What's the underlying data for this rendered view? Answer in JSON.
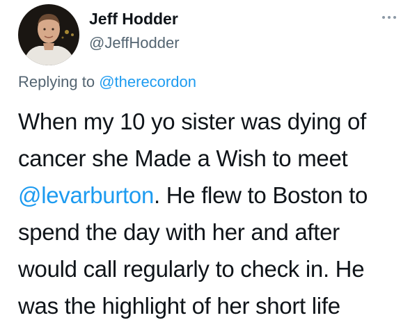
{
  "author": {
    "display_name": "Jeff Hodder",
    "handle": "@JeffHodder",
    "avatar_icon": "profile-photo"
  },
  "reply": {
    "prefix": "Replying to",
    "mention": "@therecordon"
  },
  "tweet": {
    "line1": "When my 10 yo sister was dying of",
    "line2": "cancer she Made a Wish to meet",
    "line3_mention": "@levarburton",
    "line3_rest": ". He flew to Boston to",
    "line4": "spend the day with her and after",
    "line5": "would call regularly to check in. He",
    "line6": "was the highlight of her short life"
  },
  "menu": {
    "icon": "more-horizontal-icon"
  },
  "colors": {
    "link": "#1d9bf0",
    "secondary_text": "#536471",
    "primary_text": "#0f1419",
    "background": "#ffffff"
  }
}
